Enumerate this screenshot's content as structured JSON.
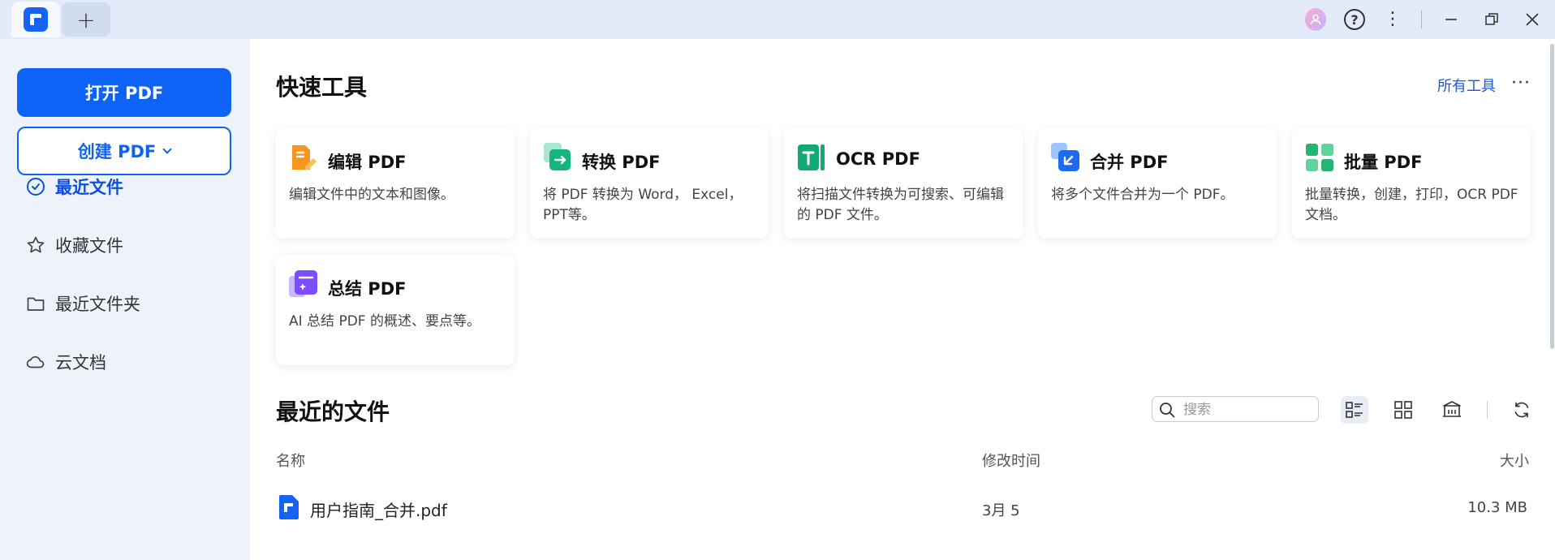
{
  "titlebar": {
    "new_tab": "+",
    "help": "?",
    "more": "⋮"
  },
  "sidebar": {
    "open_button": "打开 PDF",
    "create_button": "创建 PDF",
    "nav": [
      {
        "label": "最近文件",
        "icon": "clock-icon",
        "active": true
      },
      {
        "label": "收藏文件",
        "icon": "star-icon",
        "active": false
      },
      {
        "label": "最近文件夹",
        "icon": "folder-icon",
        "active": false
      },
      {
        "label": "云文档",
        "icon": "cloud-icon",
        "active": false
      }
    ]
  },
  "quick_tools": {
    "title": "快速工具",
    "all_tools": "所有工具",
    "more": "···",
    "cards": [
      {
        "title": "编辑 PDF",
        "desc": "编辑文件中的文本和图像。",
        "icon": "edit-pdf-icon"
      },
      {
        "title": "转换 PDF",
        "desc": "将 PDF 转换为 Word， Excel，PPT等。",
        "icon": "convert-pdf-icon"
      },
      {
        "title": "OCR PDF",
        "desc": "将扫描文件转换为可搜索、可编辑的 PDF 文件。",
        "icon": "ocr-pdf-icon"
      },
      {
        "title": "合并 PDF",
        "desc": "将多个文件合并为一个 PDF。",
        "icon": "merge-pdf-icon"
      },
      {
        "title": "批量 PDF",
        "desc": "批量转换，创建，打印，OCR PDF 文档。",
        "icon": "batch-pdf-icon"
      },
      {
        "title": "总结 PDF",
        "desc": "AI 总结 PDF 的概述、要点等。",
        "icon": "summarize-pdf-icon"
      }
    ]
  },
  "recent": {
    "title": "最近的文件",
    "search_placeholder": "搜索",
    "columns": {
      "name": "名称",
      "modified": "修改时间",
      "size": "大小"
    },
    "files": [
      {
        "name": "用户指南_合并.pdf",
        "modified": "3月 5",
        "size": "10.3 MB"
      }
    ]
  },
  "colors": {
    "accent": "#0d63f5",
    "sidebar_bg": "#eef3fb",
    "titlebar_bg": "#e3ebfa"
  }
}
